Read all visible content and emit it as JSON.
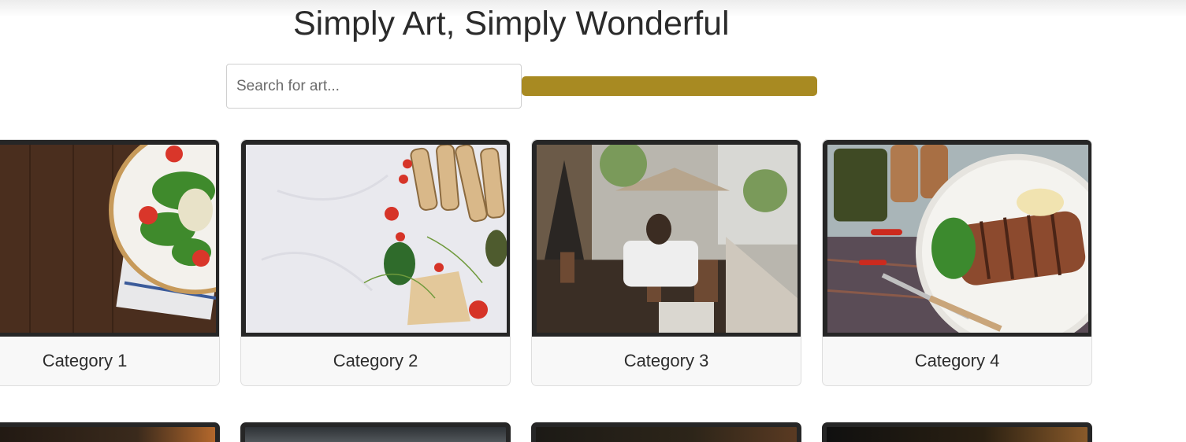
{
  "header": {
    "title": "Simply Art, Simply Wonderful"
  },
  "search": {
    "placeholder": "Search for art...",
    "value": "",
    "button_color": "#a88a22"
  },
  "categories": [
    {
      "label": "Category 1",
      "image": "salad-plate-on-wooden-table"
    },
    {
      "label": "Category 2",
      "image": "bread-tomatoes-herbs-on-marble"
    },
    {
      "label": "Category 3",
      "image": "man-at-street-cafe"
    },
    {
      "label": "Category 4",
      "image": "grilled-steak-plate-with-sauces"
    }
  ],
  "second_row_images": [
    "dark-food-photo",
    "gray-fabric-photo",
    "dark-bar-photo",
    "dark-food-closeup"
  ]
}
